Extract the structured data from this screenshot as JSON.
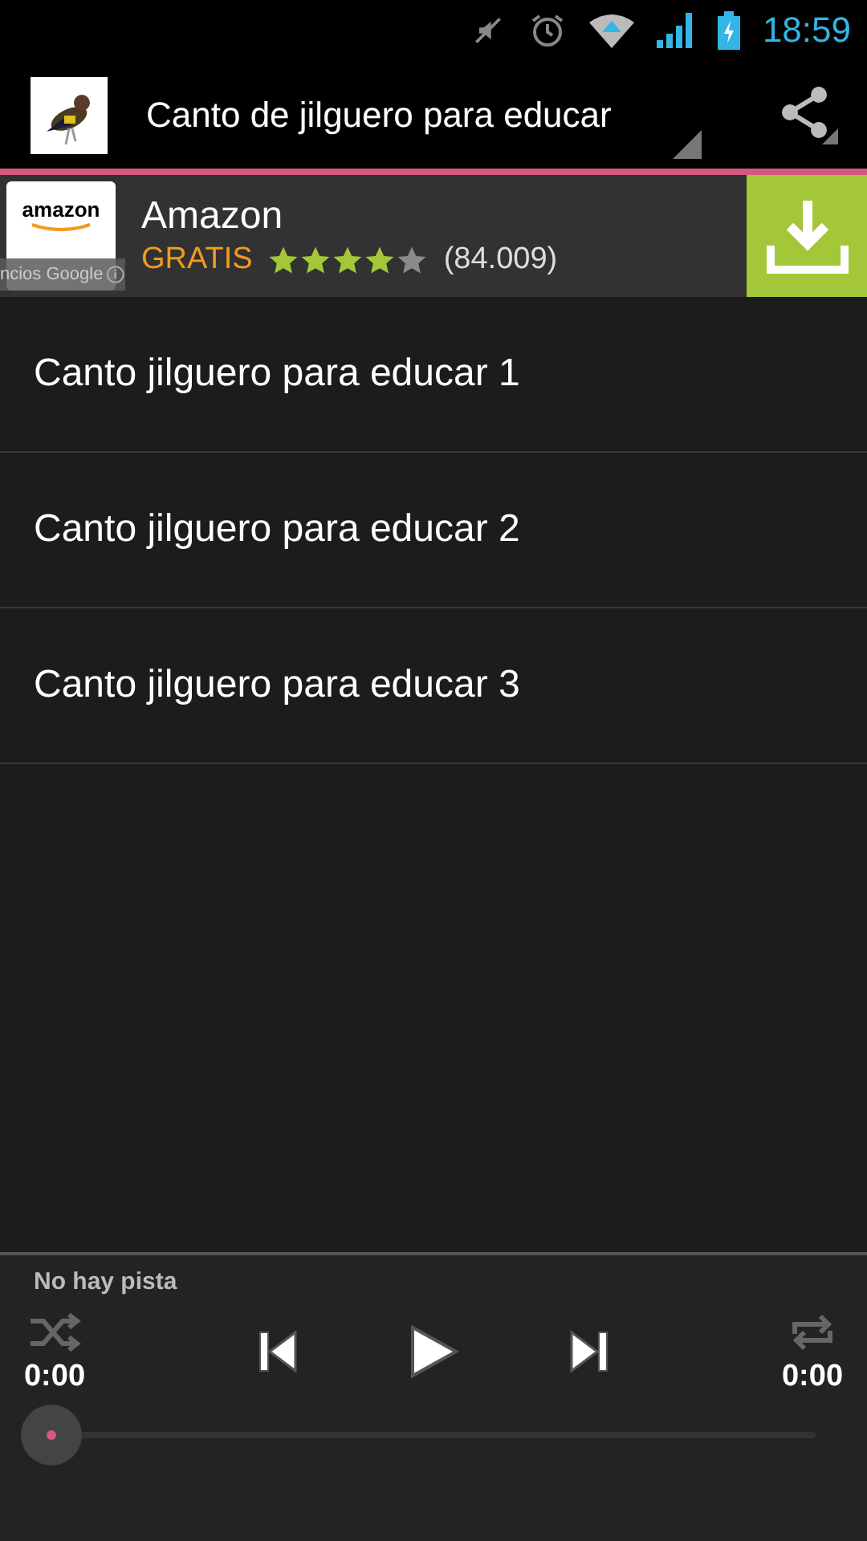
{
  "status_bar": {
    "time": "18:59"
  },
  "action_bar": {
    "title": "Canto de jilguero para educar"
  },
  "ad": {
    "logo_text": "amazon",
    "app_name": "Amazon",
    "price": "GRATIS",
    "stars": 4,
    "reviews": "(84.009)",
    "overlay_label": "ncios Google"
  },
  "tracks": [
    {
      "title": "Canto jilguero para educar 1"
    },
    {
      "title": "Canto jilguero para educar 2"
    },
    {
      "title": "Canto jilguero para educar 3"
    }
  ],
  "player": {
    "track": "No hay pista",
    "elapsed": "0:00",
    "total": "0:00",
    "progress": {
      "level": 0
    }
  }
}
